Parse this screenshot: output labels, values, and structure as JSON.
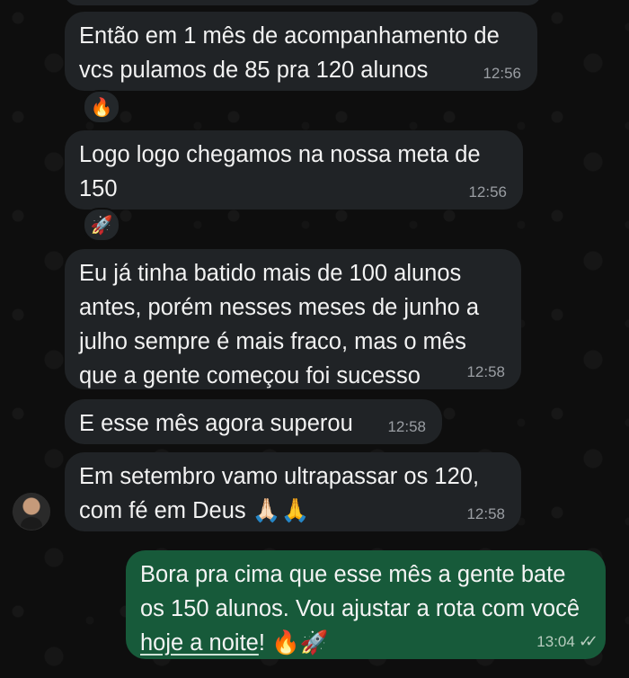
{
  "messages": [
    {
      "text": "Então em 1 mês de acompanhamento de vcs pulamos de 85 pra 120 alunos",
      "time": "12:56",
      "reaction": "🔥"
    },
    {
      "text": "Logo logo chegamos na nossa meta de 150",
      "time": "12:56",
      "reaction": "🚀"
    },
    {
      "text": "Eu já tinha batido mais de 100 alunos antes, porém nesses meses de junho a julho sempre é mais fraco, mas o mês que a gente começou foi sucesso",
      "time": "12:58"
    },
    {
      "text": "E esse mês agora superou",
      "time": "12:58"
    },
    {
      "text": "Em setembro vamo ultrapassar os 120, com fé em Deus 🙏🏻🙏",
      "time": "12:58"
    }
  ],
  "outgoing": {
    "text_before": "Bora pra cima que esse mês a gente bate os 150 alunos. Vou ajustar a rota com você ",
    "link_text": "hoje a noite",
    "text_after": "! 🔥🚀",
    "time": "13:04",
    "status_icon": "double-check-icon"
  }
}
